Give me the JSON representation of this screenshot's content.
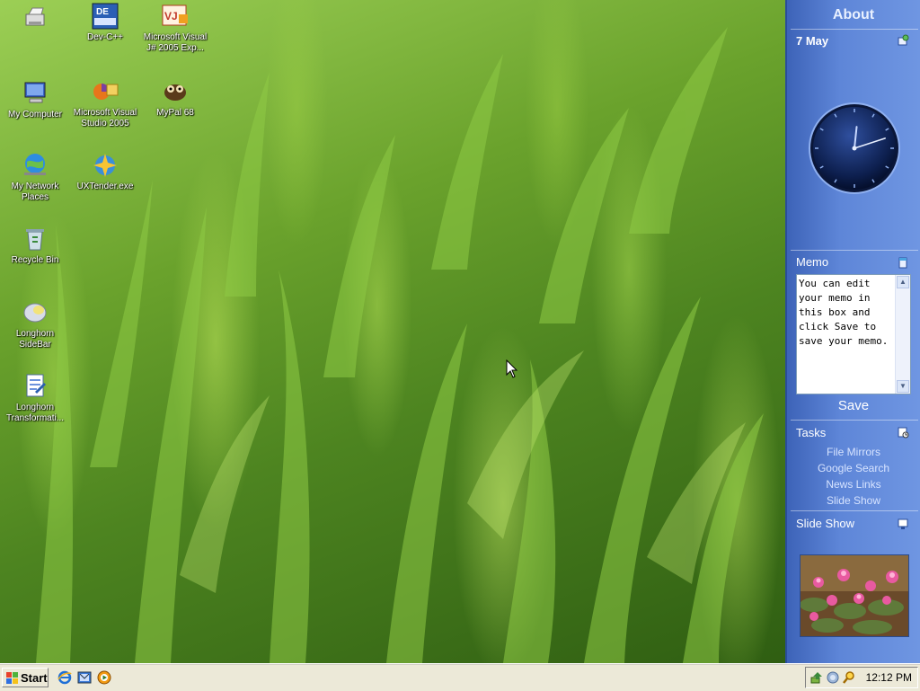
{
  "desktop": {
    "icons": [
      {
        "label": "",
        "icon": "printer-icon"
      },
      {
        "label": "Dev-C++",
        "icon": "devcpp-icon"
      },
      {
        "label": "Microsoft Visual J# 2005 Exp...",
        "icon": "vjsharp-icon"
      },
      {
        "label": "My Computer",
        "icon": "computer-icon"
      },
      {
        "label": "Microsoft Visual Studio 2005",
        "icon": "visual-studio-icon"
      },
      {
        "label": "MyPal 68",
        "icon": "mypal-icon"
      },
      {
        "label": "My Network Places",
        "icon": "network-places-icon"
      },
      {
        "label": "UXTender.exe",
        "icon": "uxtender-icon"
      },
      {
        "label": "Recycle Bin",
        "icon": "recycle-bin-icon"
      },
      {
        "label": "Longhorn SideBar",
        "icon": "longhorn-sidebar-icon"
      },
      {
        "label": "Longhorn Transformati...",
        "icon": "longhorn-transformation-icon"
      }
    ]
  },
  "sidebar": {
    "title": "About",
    "date": "7 May",
    "clock": {
      "hour": 12,
      "minute": 12
    },
    "memo": {
      "heading": "Memo",
      "text": "You can edit your memo in this box and click Save to save your memo.",
      "save_label": "Save"
    },
    "tasks": {
      "heading": "Tasks",
      "items": [
        "File Mirrors",
        "Google Search",
        "News Links",
        "Slide Show"
      ]
    },
    "slideshow": {
      "heading": "Slide Show"
    },
    "colors": {
      "panel": "#5e86d8",
      "border": "#2a4d9a"
    }
  },
  "taskbar": {
    "start_label": "Start",
    "quick_launch": [
      "internet-explorer-icon",
      "outlook-express-icon",
      "media-player-icon"
    ],
    "tray_icons": [
      "safely-remove-icon",
      "network-icon",
      "search-icon"
    ],
    "time": "12:12 PM"
  }
}
